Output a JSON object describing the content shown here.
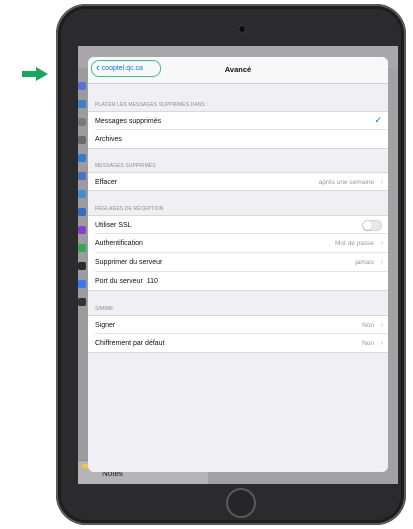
{
  "colors": {
    "accent_blue": "#007aff",
    "highlight_green": "#3bc28a",
    "arrow_green": "#17a85f",
    "modal_background": "#efeff4"
  },
  "background_app": {
    "notes_label": "Notes"
  },
  "nav": {
    "back_label": "cooptel.qc.ca",
    "title": "Avancé"
  },
  "sections": {
    "deleted_location": {
      "header": "PLACER LES MESSAGES SUPPRIMÉS DANS :",
      "items": [
        {
          "label": "Messages supprimés",
          "selected": true
        },
        {
          "label": "Archives",
          "selected": false
        }
      ]
    },
    "deleted_messages": {
      "header": "MESSAGES SUPPRIMÉS",
      "items": [
        {
          "label": "Effacer",
          "value": "après une semaine"
        }
      ]
    },
    "incoming": {
      "header": "RÉGLAGES DE RÉCEPTION",
      "use_ssl": {
        "label": "Utiliser SSL",
        "enabled": false
      },
      "auth": {
        "label": "Authentification",
        "value": "Mot de passe"
      },
      "delete_server": {
        "label": "Supprimer du serveur",
        "value": "jamais"
      },
      "port": {
        "label": "Port du serveur",
        "value": "110"
      }
    },
    "smime": {
      "header": "S/MIME",
      "sign": {
        "label": "Signer",
        "value": "Non"
      },
      "encrypt": {
        "label": "Chiffrement par défaut",
        "value": "Non"
      }
    }
  }
}
